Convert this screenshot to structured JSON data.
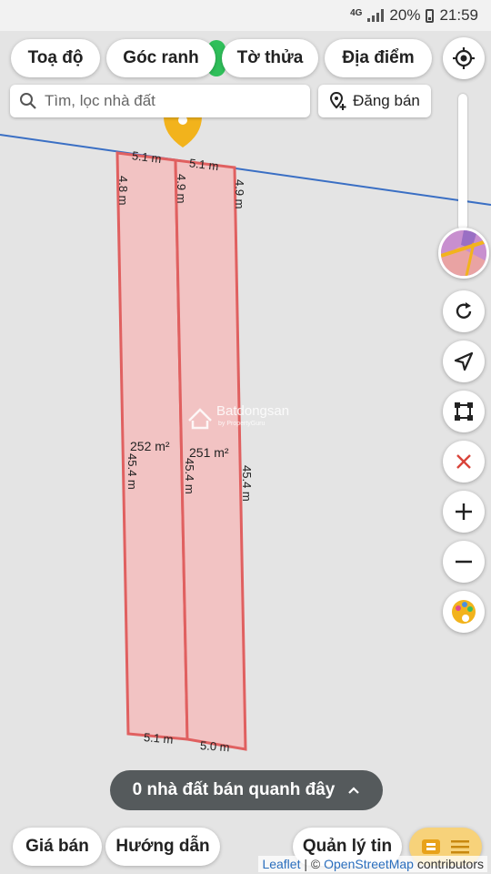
{
  "status_bar": {
    "network": "4G",
    "battery": "20%",
    "time": "21:59"
  },
  "toolbar": {
    "chips": [
      {
        "label": "Toạ độ"
      },
      {
        "label": "Góc ranh"
      },
      {
        "label": "Tờ thửa"
      },
      {
        "label": "Địa điểm"
      }
    ]
  },
  "search": {
    "placeholder": "Tìm, lọc nhà đất"
  },
  "post_button": {
    "label": "Đăng bán"
  },
  "map": {
    "watermark": "Batdongsan",
    "watermark_sub": "by PropertyGuru",
    "parcel_color": "#f2c3c3",
    "parcel_border_color": "#e06060",
    "line_color": "#3a6fc4",
    "parcels": [
      {
        "area": "252 m²",
        "top": "5.1 m",
        "bottom": "5.1 m",
        "left": "45.4 m",
        "top_left_side": "4.8 m"
      },
      {
        "area": "251 m²",
        "top": "5.1 m",
        "bottom": "5.0 m",
        "left": "45.4 m",
        "right": "45.4 m",
        "top_left_side": "4.9 m",
        "top_right_side": "4.9 m"
      }
    ]
  },
  "side_controls": [
    {
      "icon": "refresh-icon"
    },
    {
      "icon": "navigation-arrow-icon"
    },
    {
      "icon": "bounding-box-icon"
    },
    {
      "icon": "close-icon"
    },
    {
      "icon": "plus-icon"
    },
    {
      "icon": "minus-icon"
    },
    {
      "icon": "palette-icon"
    }
  ],
  "listing_pill": {
    "label": "0 nhà đất bán quanh đây"
  },
  "bottom_bar": {
    "price_label": "Giá bán",
    "guide_label": "Hướng dẫn",
    "manage_label": "Quản lý tin"
  },
  "attribution": {
    "leaflet": "Leaflet",
    "separator": " | © ",
    "osm": "OpenStreetMap",
    "contributors": " contributors"
  }
}
